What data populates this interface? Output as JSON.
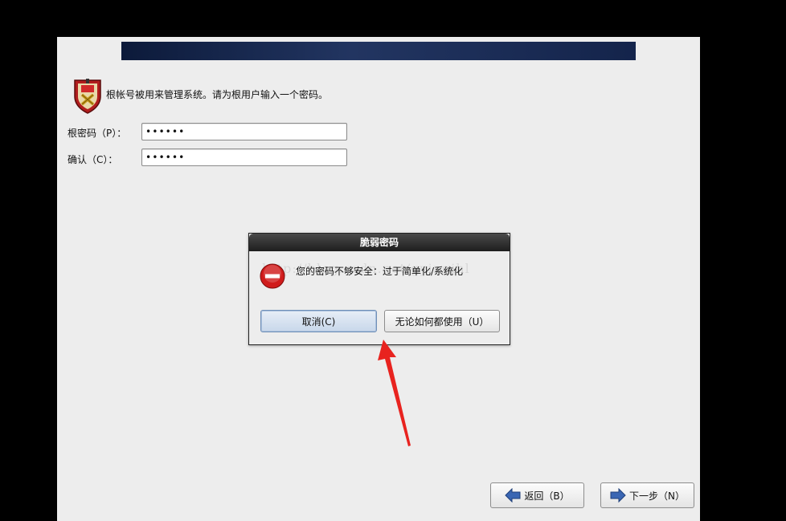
{
  "intro": {
    "text": "根帐号被用来管理系统。请为根用户输入一个密码。"
  },
  "form": {
    "root_password_label": "根密码（P）：",
    "root_password_value": "••••••",
    "confirm_label": "确认（C）：",
    "confirm_value": "••••••"
  },
  "dialog": {
    "title": "脆弱密码",
    "message": "您的密码不够安全：过于简单化/系统化",
    "watermark": "http://blog.csdn.net/gyingihl",
    "cancel_label": "取消(C)",
    "use_anyway_label": "无论如何都使用（U）"
  },
  "nav": {
    "back_label": "返回（B）",
    "next_label": "下一步（N）"
  },
  "icons": {
    "shield": "root-shield-icon",
    "error": "error-stop-icon",
    "back": "arrow-left-icon",
    "next": "arrow-right-icon"
  },
  "colors": {
    "banner": "#14244b",
    "error_red": "#d01c1c",
    "nav_arrow_blue": "#3a66b3",
    "annotation_red": "#e8231f"
  }
}
